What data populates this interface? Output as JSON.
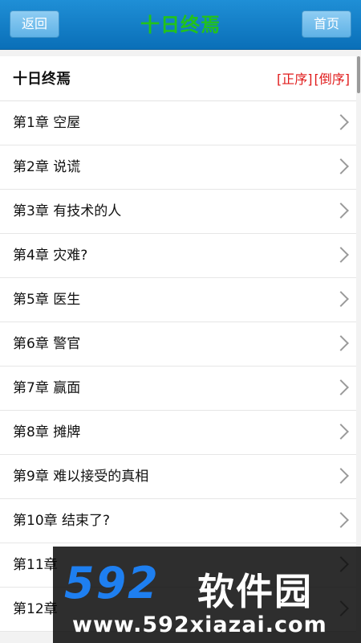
{
  "header": {
    "back_label": "返回",
    "title": "十日终焉",
    "home_label": "首页"
  },
  "book": {
    "name": "十日终焉",
    "order_asc": "[正序]",
    "order_desc": "[倒序]"
  },
  "chapters": [
    "第1章 空屋",
    "第2章 说谎",
    "第3章 有技术的人",
    "第4章 灾难?",
    "第5章 医生",
    "第6章 警官",
    "第7章 赢面",
    "第8章 摊牌",
    "第9章 难以接受的真相",
    "第10章 结束了?",
    "第11章",
    "第12章"
  ],
  "watermark": {
    "number": "592",
    "brand": "软件园",
    "url": "www.592xiazai.com"
  },
  "colors": {
    "topbar": "#0a6fb8",
    "title": "#22c21c",
    "order": "#e01a1a"
  }
}
